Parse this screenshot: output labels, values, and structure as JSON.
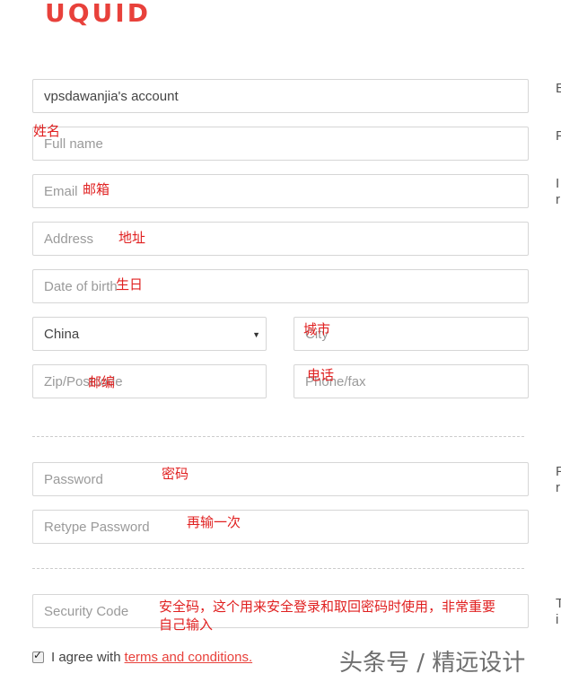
{
  "brand": {
    "logo_text": "UQUID",
    "accent": "#e8413b"
  },
  "form": {
    "account": {
      "value": "vpsdawanjia's account"
    },
    "full_name": {
      "placeholder": "Full name",
      "annotation": "姓名"
    },
    "email": {
      "placeholder": "Email",
      "annotation": "邮箱"
    },
    "address": {
      "placeholder": "Address",
      "annotation": "地址"
    },
    "dob": {
      "placeholder": "Date of birth",
      "annotation": "生日"
    },
    "country": {
      "selected": "China"
    },
    "city": {
      "placeholder": "City",
      "annotation": "城市"
    },
    "zip": {
      "placeholder": "Zip/Postcode",
      "annotation": "邮编"
    },
    "phone": {
      "placeholder": "Phone/fax",
      "annotation": "电话"
    },
    "password": {
      "placeholder": "Password",
      "annotation": "密码"
    },
    "retype": {
      "placeholder": "Retype Password",
      "annotation": "再输一次"
    },
    "security": {
      "placeholder": "Security Code",
      "annotation_line1": "安全码，这个用来安全登录和取回密码时使用，非常重要",
      "annotation_line2": "自己输入"
    },
    "agree": {
      "prefix": "I agree with",
      "link": "terms and conditions.",
      "checked": true
    }
  },
  "side_text": {
    "row1": "E",
    "row2": "F",
    "row3a": "I",
    "row3b": "r",
    "row4a": "F",
    "row4b": "r",
    "row5a": "T",
    "row5b": "i"
  },
  "watermark": "头条号 / 精远设计"
}
